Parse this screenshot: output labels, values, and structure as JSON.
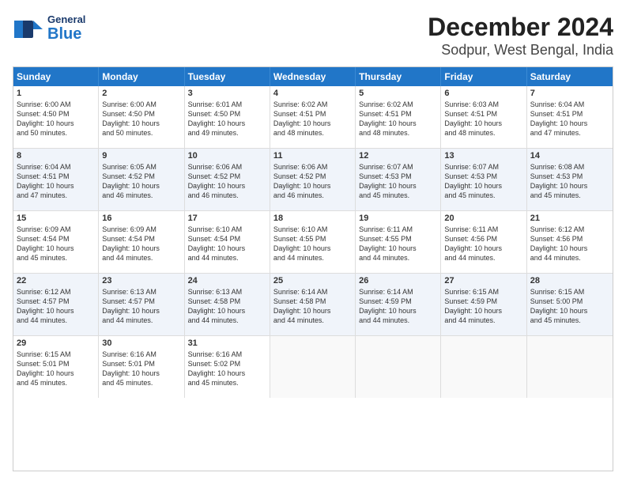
{
  "header": {
    "logo_general": "General",
    "logo_blue": "Blue",
    "title": "December 2024",
    "subtitle": "Sodpur, West Bengal, India"
  },
  "days_of_week": [
    "Sunday",
    "Monday",
    "Tuesday",
    "Wednesday",
    "Thursday",
    "Friday",
    "Saturday"
  ],
  "rows": [
    {
      "alt": false,
      "cells": [
        {
          "day": "1",
          "info": "Sunrise: 6:00 AM\nSunset: 4:50 PM\nDaylight: 10 hours\nand 50 minutes."
        },
        {
          "day": "2",
          "info": "Sunrise: 6:00 AM\nSunset: 4:50 PM\nDaylight: 10 hours\nand 50 minutes."
        },
        {
          "day": "3",
          "info": "Sunrise: 6:01 AM\nSunset: 4:50 PM\nDaylight: 10 hours\nand 49 minutes."
        },
        {
          "day": "4",
          "info": "Sunrise: 6:02 AM\nSunset: 4:51 PM\nDaylight: 10 hours\nand 48 minutes."
        },
        {
          "day": "5",
          "info": "Sunrise: 6:02 AM\nSunset: 4:51 PM\nDaylight: 10 hours\nand 48 minutes."
        },
        {
          "day": "6",
          "info": "Sunrise: 6:03 AM\nSunset: 4:51 PM\nDaylight: 10 hours\nand 48 minutes."
        },
        {
          "day": "7",
          "info": "Sunrise: 6:04 AM\nSunset: 4:51 PM\nDaylight: 10 hours\nand 47 minutes."
        }
      ]
    },
    {
      "alt": true,
      "cells": [
        {
          "day": "8",
          "info": "Sunrise: 6:04 AM\nSunset: 4:51 PM\nDaylight: 10 hours\nand 47 minutes."
        },
        {
          "day": "9",
          "info": "Sunrise: 6:05 AM\nSunset: 4:52 PM\nDaylight: 10 hours\nand 46 minutes."
        },
        {
          "day": "10",
          "info": "Sunrise: 6:06 AM\nSunset: 4:52 PM\nDaylight: 10 hours\nand 46 minutes."
        },
        {
          "day": "11",
          "info": "Sunrise: 6:06 AM\nSunset: 4:52 PM\nDaylight: 10 hours\nand 46 minutes."
        },
        {
          "day": "12",
          "info": "Sunrise: 6:07 AM\nSunset: 4:53 PM\nDaylight: 10 hours\nand 45 minutes."
        },
        {
          "day": "13",
          "info": "Sunrise: 6:07 AM\nSunset: 4:53 PM\nDaylight: 10 hours\nand 45 minutes."
        },
        {
          "day": "14",
          "info": "Sunrise: 6:08 AM\nSunset: 4:53 PM\nDaylight: 10 hours\nand 45 minutes."
        }
      ]
    },
    {
      "alt": false,
      "cells": [
        {
          "day": "15",
          "info": "Sunrise: 6:09 AM\nSunset: 4:54 PM\nDaylight: 10 hours\nand 45 minutes."
        },
        {
          "day": "16",
          "info": "Sunrise: 6:09 AM\nSunset: 4:54 PM\nDaylight: 10 hours\nand 44 minutes."
        },
        {
          "day": "17",
          "info": "Sunrise: 6:10 AM\nSunset: 4:54 PM\nDaylight: 10 hours\nand 44 minutes."
        },
        {
          "day": "18",
          "info": "Sunrise: 6:10 AM\nSunset: 4:55 PM\nDaylight: 10 hours\nand 44 minutes."
        },
        {
          "day": "19",
          "info": "Sunrise: 6:11 AM\nSunset: 4:55 PM\nDaylight: 10 hours\nand 44 minutes."
        },
        {
          "day": "20",
          "info": "Sunrise: 6:11 AM\nSunset: 4:56 PM\nDaylight: 10 hours\nand 44 minutes."
        },
        {
          "day": "21",
          "info": "Sunrise: 6:12 AM\nSunset: 4:56 PM\nDaylight: 10 hours\nand 44 minutes."
        }
      ]
    },
    {
      "alt": true,
      "cells": [
        {
          "day": "22",
          "info": "Sunrise: 6:12 AM\nSunset: 4:57 PM\nDaylight: 10 hours\nand 44 minutes."
        },
        {
          "day": "23",
          "info": "Sunrise: 6:13 AM\nSunset: 4:57 PM\nDaylight: 10 hours\nand 44 minutes."
        },
        {
          "day": "24",
          "info": "Sunrise: 6:13 AM\nSunset: 4:58 PM\nDaylight: 10 hours\nand 44 minutes."
        },
        {
          "day": "25",
          "info": "Sunrise: 6:14 AM\nSunset: 4:58 PM\nDaylight: 10 hours\nand 44 minutes."
        },
        {
          "day": "26",
          "info": "Sunrise: 6:14 AM\nSunset: 4:59 PM\nDaylight: 10 hours\nand 44 minutes."
        },
        {
          "day": "27",
          "info": "Sunrise: 6:15 AM\nSunset: 4:59 PM\nDaylight: 10 hours\nand 44 minutes."
        },
        {
          "day": "28",
          "info": "Sunrise: 6:15 AM\nSunset: 5:00 PM\nDaylight: 10 hours\nand 45 minutes."
        }
      ]
    },
    {
      "alt": false,
      "cells": [
        {
          "day": "29",
          "info": "Sunrise: 6:15 AM\nSunset: 5:01 PM\nDaylight: 10 hours\nand 45 minutes."
        },
        {
          "day": "30",
          "info": "Sunrise: 6:16 AM\nSunset: 5:01 PM\nDaylight: 10 hours\nand 45 minutes."
        },
        {
          "day": "31",
          "info": "Sunrise: 6:16 AM\nSunset: 5:02 PM\nDaylight: 10 hours\nand 45 minutes."
        },
        {
          "day": "",
          "info": ""
        },
        {
          "day": "",
          "info": ""
        },
        {
          "day": "",
          "info": ""
        },
        {
          "day": "",
          "info": ""
        }
      ]
    }
  ]
}
